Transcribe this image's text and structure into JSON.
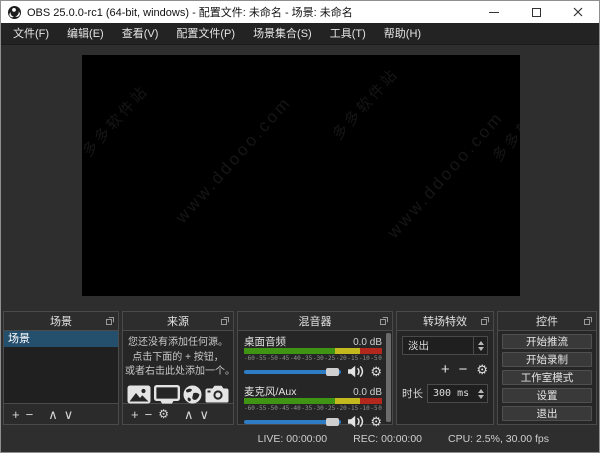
{
  "window": {
    "title": "OBS 25.0.0-rc1 (64-bit, windows) - 配置文件: 未命名 - 场景: 未命名"
  },
  "menu": {
    "items": [
      "文件(F)",
      "编辑(E)",
      "查看(V)",
      "配置文件(P)",
      "场景集合(S)",
      "工具(T)",
      "帮助(H)"
    ]
  },
  "preview": {
    "watermarks": [
      "多多软件站",
      "www.ddooo.com",
      "多多软件站",
      "www.ddooo.com",
      "多多软件站"
    ]
  },
  "panels": {
    "scenes": {
      "title": "场景",
      "items": [
        {
          "label": "场景",
          "selected": true
        }
      ],
      "toolbar": {
        "add": "+",
        "remove": "−",
        "up": "∧",
        "down": "∨"
      }
    },
    "sources": {
      "title": "来源",
      "empty_lines": [
        "您还没有添加任何源。",
        "点击下面的 + 按钮，",
        "或者右击此处添加一个。"
      ],
      "icons": [
        "image-icon",
        "display-icon",
        "globe-icon",
        "camera-icon"
      ],
      "toolbar": {
        "add": "+",
        "remove": "−",
        "settings": "⚙",
        "up": "∧",
        "down": "∨"
      }
    },
    "mixer": {
      "title": "混音器",
      "ticks": [
        "-60",
        "-55",
        "-50",
        "-45",
        "-40",
        "-35",
        "-30",
        "-25",
        "-20",
        "-15",
        "-10",
        "-5",
        "0"
      ],
      "channels": [
        {
          "name": "桌面音频",
          "level": "0.0 dB"
        },
        {
          "name": "麦克风/Aux",
          "level": "0.0 dB"
        }
      ],
      "accent_blue": "#2d7cc4",
      "meter_green": "#3f9413",
      "meter_yellow": "#c4ba1e",
      "meter_red": "#b3271d"
    },
    "transitions": {
      "title": "转场特效",
      "selected": "淡出",
      "toolbar": {
        "add": "+",
        "remove": "−",
        "settings": "⚙"
      },
      "duration_label": "时长",
      "duration_value": "300 ms"
    },
    "controls": {
      "title": "控件",
      "buttons": [
        "开始推流",
        "开始录制",
        "工作室模式",
        "设置",
        "退出"
      ]
    }
  },
  "statusbar": {
    "live": "LIVE: 00:00:00",
    "rec": "REC: 00:00:00",
    "cpu": "CPU: 2.5%, 30.00 fps"
  }
}
